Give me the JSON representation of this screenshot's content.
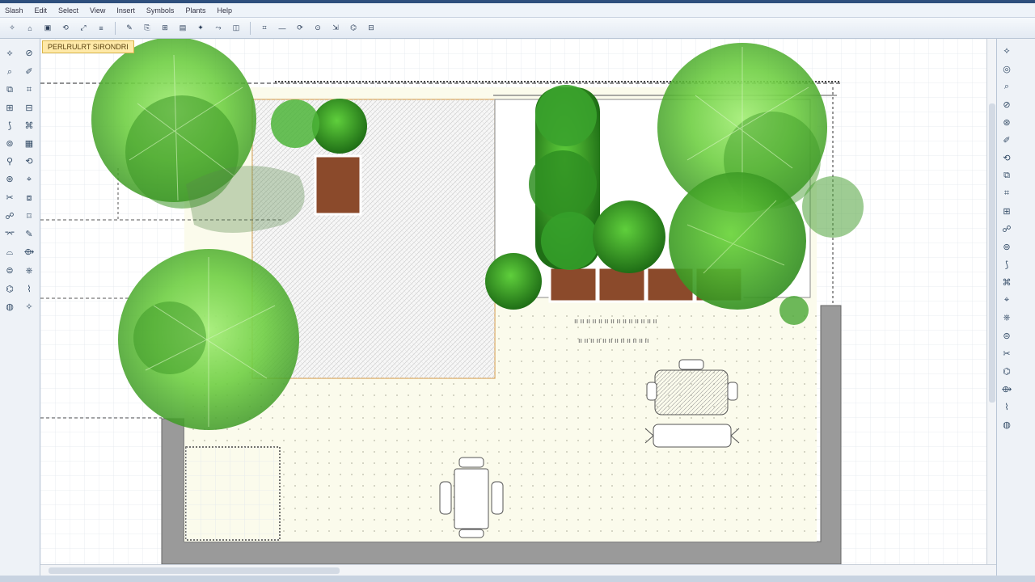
{
  "menu": {
    "items": [
      "Slash",
      "Edit",
      "Select",
      "View",
      "Insert",
      "Symbols",
      "Plants",
      "Help"
    ]
  },
  "toolbar": {
    "buttons": [
      "✧",
      "⌂",
      "▣",
      "⟲",
      "⤢",
      "≡",
      "✎",
      "⎘",
      "⊞",
      "▤",
      "✦",
      "⤳",
      "◫",
      "⌗",
      "—",
      "⟳",
      "⊙",
      "⇲",
      "⌬",
      "⊟"
    ]
  },
  "document": {
    "tab_label": "PERLRULRT SIRONDRI"
  },
  "canvas": {
    "annotation_text": "ıı ıı ıı ıı ıı ıı ıı ıı ıı ıı ıı ıı ıı ıı",
    "annotation_text2": "ıı ıı ıı ıı ıı ıı ıı ıı ıı ıı ıı ıı"
  },
  "left_tools": {
    "icons": [
      "⟡",
      "⊘",
      "⌕",
      "✐",
      "⧉",
      "⌗",
      "⊞",
      "⊟",
      "⟆",
      "⌘",
      "⊚",
      "▦",
      "⚲",
      "⟲",
      "⊛",
      "⌖",
      "✂",
      "⧈",
      "☍",
      "⌑",
      "⌤",
      "✎",
      "⌓",
      "⟴",
      "⊜",
      "⎈",
      "⌬",
      "⌇",
      "◍",
      "✧"
    ]
  },
  "right_tools": {
    "icons": [
      "⟡",
      "◎",
      "⌕",
      "⊘",
      "⊛",
      "✐",
      "⟲",
      "⧉",
      "⌗",
      "⊞",
      "☍",
      "⊚",
      "⟆",
      "⌘",
      "⌖",
      "⎈",
      "⊜",
      "✂",
      "⌬",
      "⟴",
      "⌇",
      "◍"
    ]
  },
  "colors": {
    "tree_light": "#7ed957",
    "tree_dark": "#3c8f2a",
    "hedge": "#2f8a26",
    "soil": "#8b4a2b",
    "wall": "#9a9a9a",
    "paving": "#fbfbec",
    "lawn_hatch": "#e6e6e6"
  }
}
